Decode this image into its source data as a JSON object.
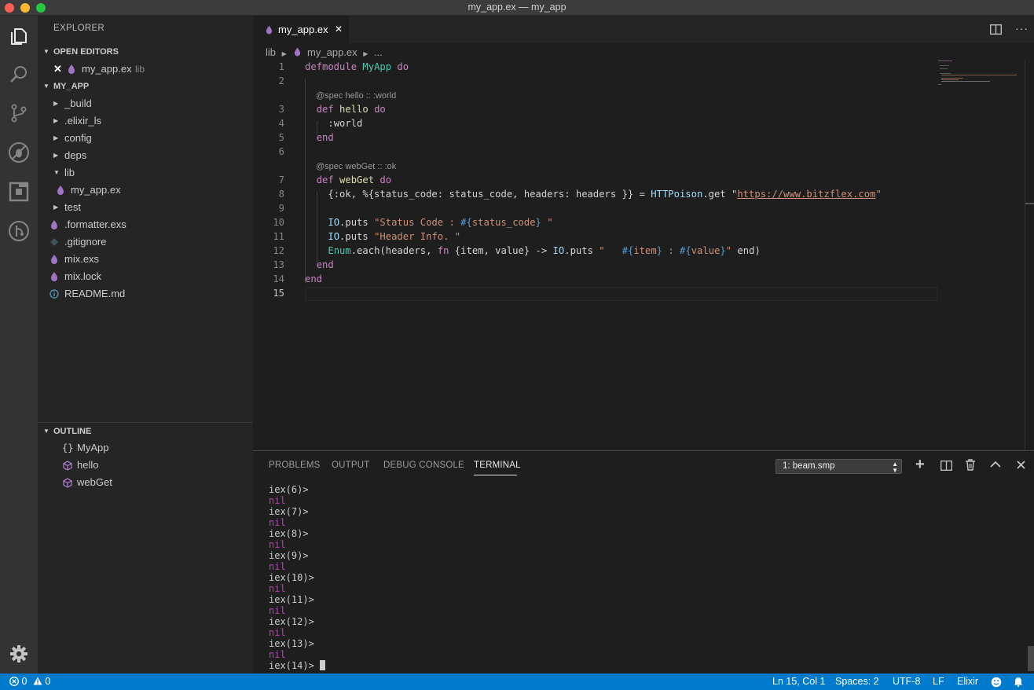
{
  "window": {
    "title": "my_app.ex — my_app"
  },
  "sidebar": {
    "title": "EXPLORER",
    "open_editors": {
      "label": "OPEN EDITORS",
      "file": "my_app.ex",
      "folder": "lib"
    },
    "project": {
      "label": "MY_APP",
      "items": [
        {
          "name": "_build",
          "type": "folder"
        },
        {
          "name": ".elixir_ls",
          "type": "folder"
        },
        {
          "name": "config",
          "type": "folder"
        },
        {
          "name": "deps",
          "type": "folder"
        },
        {
          "name": "lib",
          "type": "folder-open"
        },
        {
          "name": "my_app.ex",
          "type": "elixir-file"
        },
        {
          "name": "test",
          "type": "folder"
        },
        {
          "name": ".formatter.exs",
          "type": "elixir-file"
        },
        {
          "name": ".gitignore",
          "type": "git-file"
        },
        {
          "name": "mix.exs",
          "type": "elixir-file"
        },
        {
          "name": "mix.lock",
          "type": "elixir-file"
        },
        {
          "name": "README.md",
          "type": "info-file"
        }
      ]
    },
    "outline": {
      "label": "OUTLINE",
      "items": [
        {
          "name": "MyApp",
          "icon": "braces-icon"
        },
        {
          "name": "hello",
          "icon": "cube-icon"
        },
        {
          "name": "webGet",
          "icon": "cube-icon"
        }
      ]
    }
  },
  "editor": {
    "tab": "my_app.ex",
    "breadcrumb": {
      "folder": "lib",
      "file": "my_app.ex",
      "more": "..."
    },
    "lenses": {
      "hello": "@spec hello :: :world",
      "webGet": "@spec webGet :: :ok"
    },
    "line_numbers": [
      "1",
      "2",
      "3",
      "4",
      "5",
      "6",
      "7",
      "8",
      "9",
      "10",
      "11",
      "12",
      "13",
      "14",
      "15"
    ],
    "code": {
      "l1_kw": "defmodule",
      "l1_mod": "MyApp",
      "l1_do": "do",
      "l3_kw": "def",
      "l3_fn": "hello",
      "l3_do": "do",
      "l4": ":world",
      "l5": "end",
      "l7_kw": "def",
      "l7_fn": "webGet",
      "l7_do": "do",
      "l8_a": "{:ok, %{status_code: status_code, headers: headers }} = ",
      "l8_mod": "HTTPoison",
      "l8_b": ".get \"",
      "l8_url": "https://www.bitzflex.com",
      "l8_c": "\"",
      "l10_mod": "IO",
      "l10_a": ".puts ",
      "l10_str": "\"Status Code : ",
      "l10_i1": "#{",
      "l10_var": "status_code",
      "l10_i2": "}",
      "l10_end": " \"",
      "l11_mod": "IO",
      "l11_a": ".puts ",
      "l11_str": "\"Header Info. \"",
      "l12_mod": "Enum",
      "l12_a": ".each(headers, ",
      "l12_fn": "fn",
      "l12_b": " {item, value} -> ",
      "l12_mod2": "IO",
      "l12_c": ".puts ",
      "l12_str": "\"   ",
      "l12_i1": "#{",
      "l12_v1": "item",
      "l12_i2": "}",
      "l12_str2": " : ",
      "l12_i3": "#{",
      "l12_v2": "value",
      "l12_i4": "}",
      "l12_str3": "\"",
      "l12_end": " end)",
      "l13": "end",
      "l14": "end"
    }
  },
  "panel": {
    "tabs": [
      "PROBLEMS",
      "OUTPUT",
      "DEBUG CONSOLE",
      "TERMINAL"
    ],
    "active_tab": "TERMINAL",
    "terminal_select": "1: beam.smp",
    "terminal_lines": [
      {
        "prompt": "iex(6)>",
        "result": "nil"
      },
      {
        "prompt": "iex(7)>",
        "result": "nil"
      },
      {
        "prompt": "iex(8)>",
        "result": "nil"
      },
      {
        "prompt": "iex(9)>",
        "result": "nil"
      },
      {
        "prompt": "iex(10)>",
        "result": "nil"
      },
      {
        "prompt": "iex(11)>",
        "result": "nil"
      },
      {
        "prompt": "iex(12)>",
        "result": "nil"
      },
      {
        "prompt": "iex(13)>",
        "result": "nil"
      }
    ],
    "current_prompt": "iex(14)>"
  },
  "status": {
    "errors": "0",
    "warnings": "0",
    "position": "Ln 15, Col 1",
    "spaces": "Spaces: 2",
    "encoding": "UTF-8",
    "eol": "LF",
    "language": "Elixir"
  },
  "colors": {
    "accent": "#007acc",
    "elixir": "#a074c4"
  }
}
